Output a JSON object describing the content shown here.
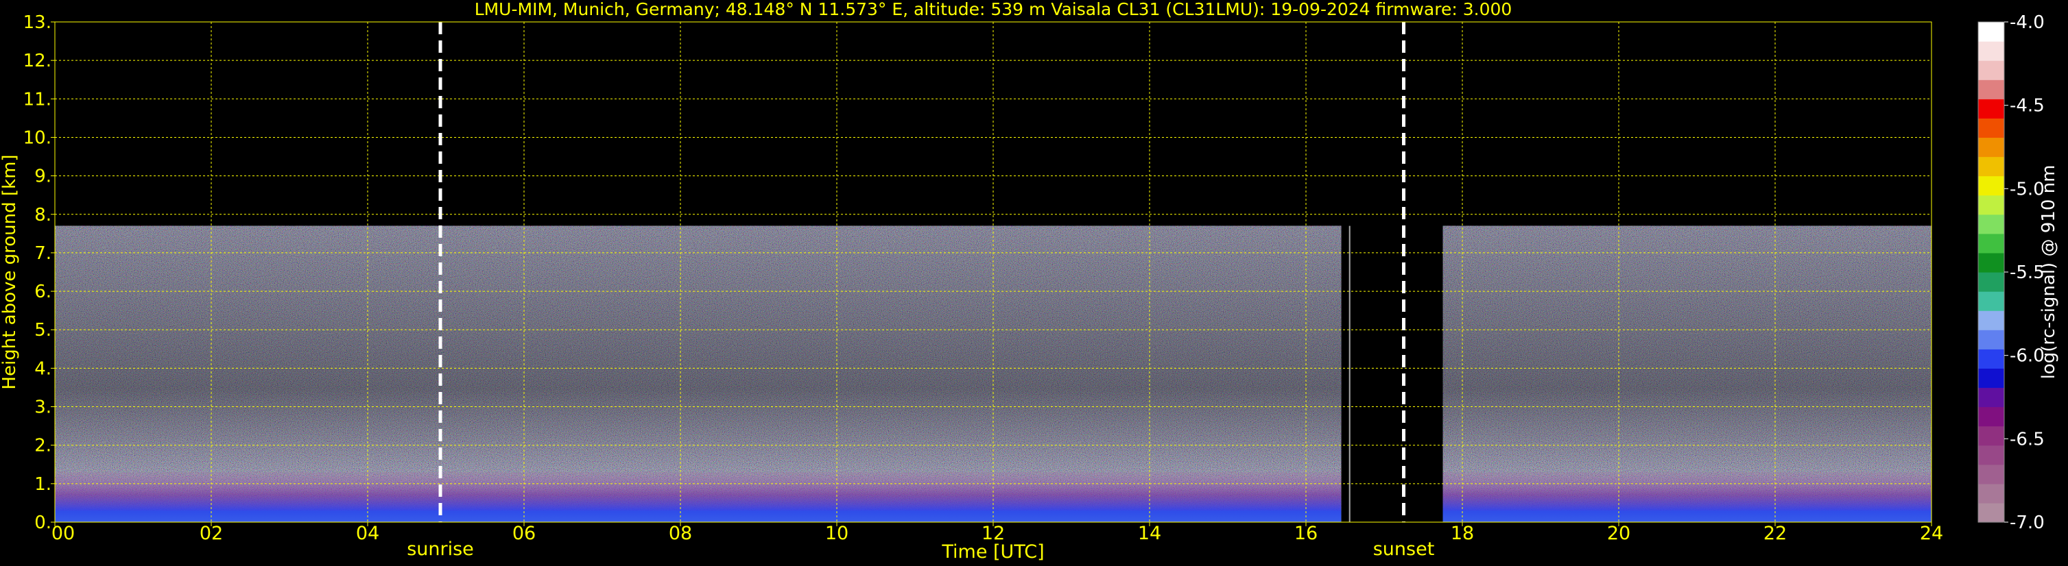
{
  "chart_data": {
    "type": "heatmap",
    "title": "LMU-MIM, Munich, Germany; 48.148° N 11.573° E, altitude: 539 m    Vaisala CL31 (CL31LMU): 19-09-2024    firmware: 3.000",
    "xlabel": "Time [UTC]",
    "ylabel": "Height above ground [km]",
    "xlim": [
      0,
      24
    ],
    "ylim": [
      0,
      13
    ],
    "x_ticks": [
      "00",
      "02",
      "04",
      "06",
      "08",
      "10",
      "12",
      "14",
      "16",
      "18",
      "20",
      "22",
      "24"
    ],
    "y_ticks": [
      "0.",
      "1.",
      "2.",
      "3.",
      "4.",
      "5.",
      "6.",
      "7.",
      "8.",
      "9.",
      "10.",
      "11.",
      "12.",
      "13."
    ],
    "grid": true,
    "events": [
      {
        "label": "sunrise",
        "time": 4.93
      },
      {
        "label": "sunset",
        "time": 17.25
      }
    ],
    "data_coverage": {
      "max_height": 7.7,
      "segments": [
        [
          0,
          16.45
        ],
        [
          17.75,
          24
        ]
      ]
    },
    "colorbar": {
      "label": "log(rc-signal) @ 910 nm",
      "ticks": [
        "-4.0",
        "-4.5",
        "-5.0",
        "-5.5",
        "-6.0",
        "-6.5",
        "-7.0"
      ],
      "range": [
        -7.0,
        -4.0
      ],
      "colors": [
        "#b08ca0",
        "#a87898",
        "#a06090",
        "#984888",
        "#903080",
        "#801080",
        "#6010a0",
        "#1010d0",
        "#2840f0",
        "#6080f0",
        "#90b0f0",
        "#40c0a0",
        "#20a060",
        "#109020",
        "#40c040",
        "#80e060",
        "#c0f040",
        "#f0f000",
        "#f0c000",
        "#f09000",
        "#f05000",
        "#f00000",
        "#e08080",
        "#f0c0c0",
        "#f8e0e0",
        "#ffffff"
      ]
    }
  }
}
